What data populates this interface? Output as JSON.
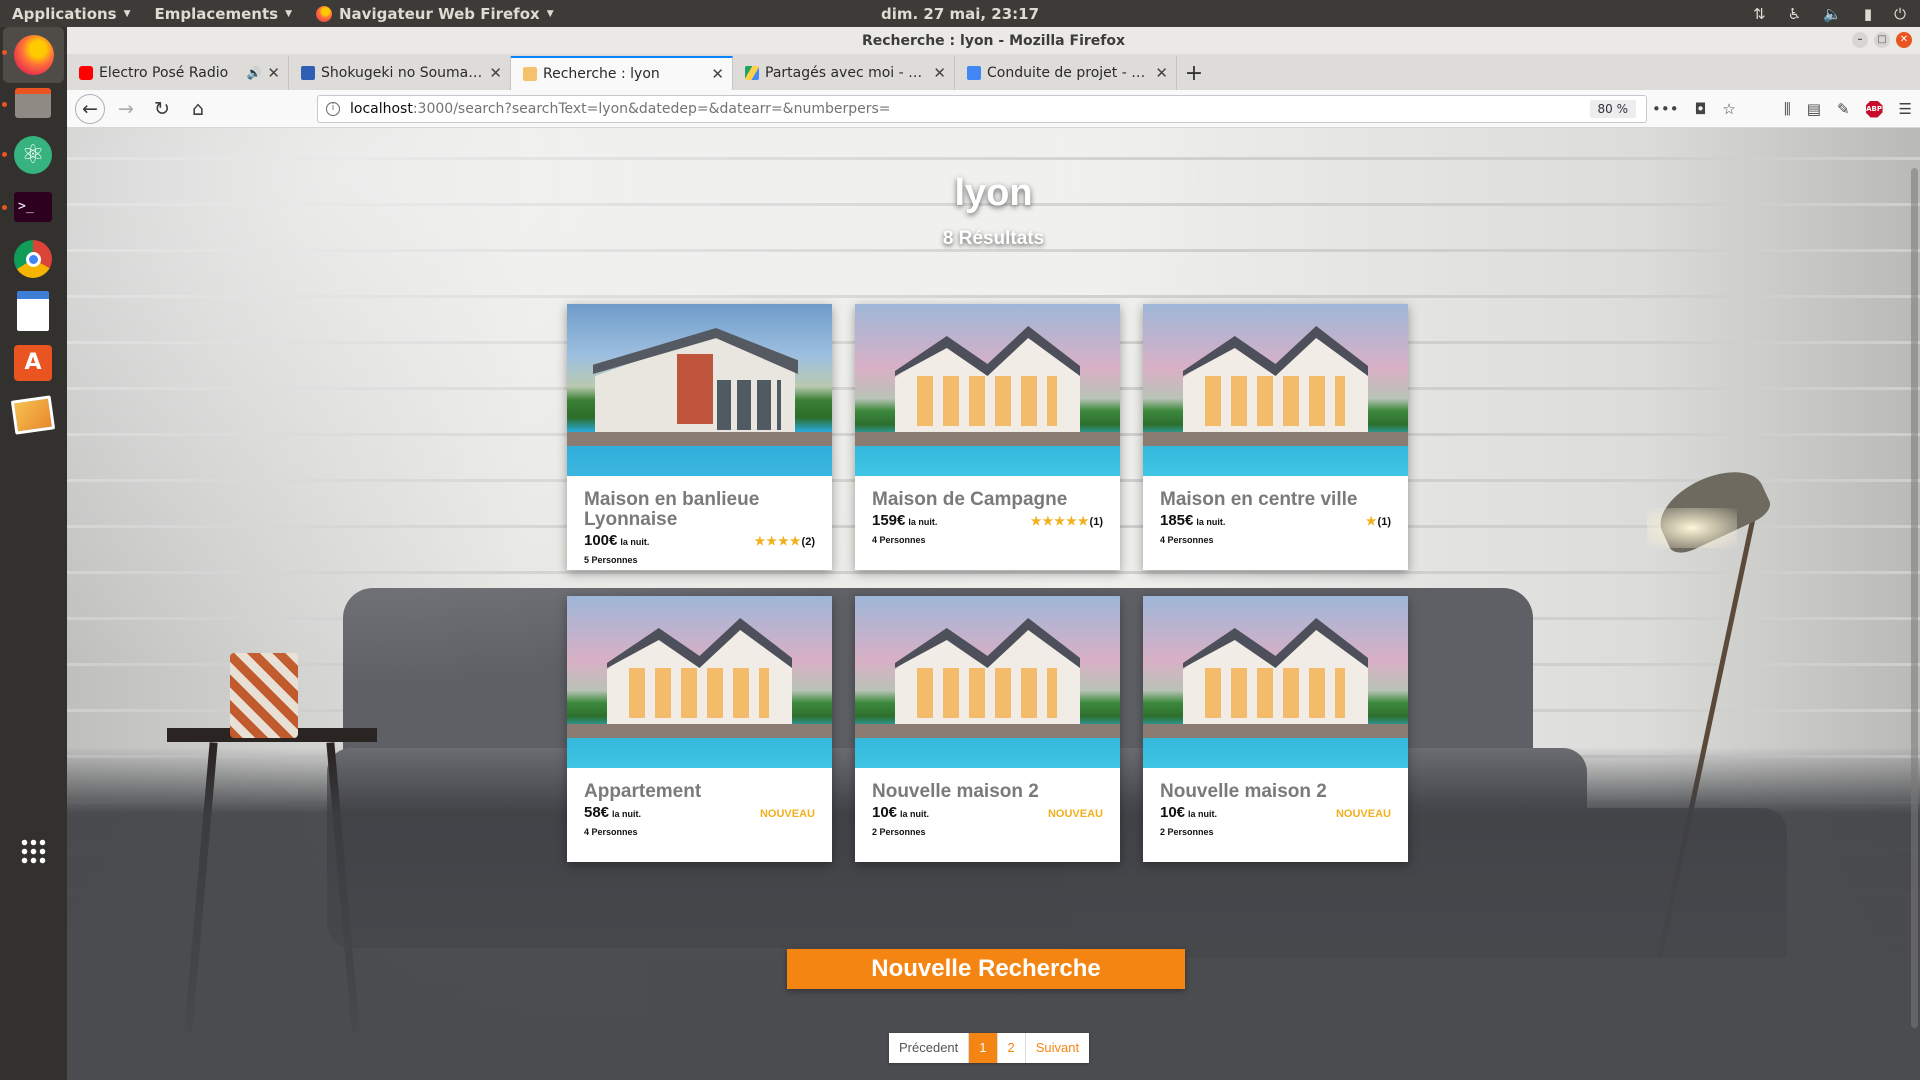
{
  "top_panel": {
    "applications": "Applications",
    "places": "Emplacements",
    "browser_menu": "Navigateur Web Firefox",
    "clock": "dim. 27 mai, 23:17"
  },
  "window": {
    "title": "Recherche : lyon - Mozilla Firefox"
  },
  "tabs": [
    {
      "title": "Electro Posé Radio",
      "icon": "youtube-icon",
      "icon_color": "#ff0000"
    },
    {
      "title": "Shokugeki no Souma : Ni",
      "icon": "bookmark-icon",
      "icon_color": "#2f5fb5"
    },
    {
      "title": "Recherche : lyon",
      "icon": "page-icon",
      "icon_color": "#f5c26b"
    },
    {
      "title": "Partagés avec moi - Goo",
      "icon": "google-drive-icon",
      "icon_color": "#1fa463"
    },
    {
      "title": "Conduite de projet - Goo",
      "icon": "google-docs-icon",
      "icon_color": "#4285f4"
    }
  ],
  "url": {
    "host": "localhost",
    "path": ":3000/search?searchText=lyon&datedep=&datearr=&numberpers=",
    "zoom": "80 %"
  },
  "page": {
    "title": "lyon",
    "result_count": "8 Résultats",
    "new_search_label": "Nouvelle Recherche"
  },
  "listings": [
    {
      "title": "Maison en banlieue Lyonnaise",
      "price": "100€",
      "per_night": "la nuit.",
      "persons": "5 Personnes",
      "stars": "★★★★",
      "reviews": "(2)",
      "badge": ""
    },
    {
      "title": "Maison de Campagne",
      "price": "159€",
      "per_night": "la nuit.",
      "persons": "4 Personnes",
      "stars": "★★★★★",
      "reviews": "(1)",
      "badge": ""
    },
    {
      "title": "Maison en centre ville",
      "price": "185€",
      "per_night": "la nuit.",
      "persons": "4 Personnes",
      "stars": "★",
      "reviews": "(1)",
      "badge": ""
    },
    {
      "title": "Appartement",
      "price": "58€",
      "per_night": "la nuit.",
      "persons": "4 Personnes",
      "stars": "",
      "reviews": "",
      "badge": "NOUVEAU"
    },
    {
      "title": "Nouvelle maison 2",
      "price": "10€",
      "per_night": "la nuit.",
      "persons": "2 Personnes",
      "stars": "",
      "reviews": "",
      "badge": "NOUVEAU"
    },
    {
      "title": "Nouvelle maison 2",
      "price": "10€",
      "per_night": "la nuit.",
      "persons": "2 Personnes",
      "stars": "",
      "reviews": "",
      "badge": "NOUVEAU"
    }
  ],
  "pagination": {
    "prev": "Précedent",
    "pages": [
      "1",
      "2"
    ],
    "current": "1",
    "next": "Suivant"
  },
  "colors": {
    "accent": "#f58513",
    "star": "#f2b01e",
    "ubuntu_orange": "#e95420"
  }
}
